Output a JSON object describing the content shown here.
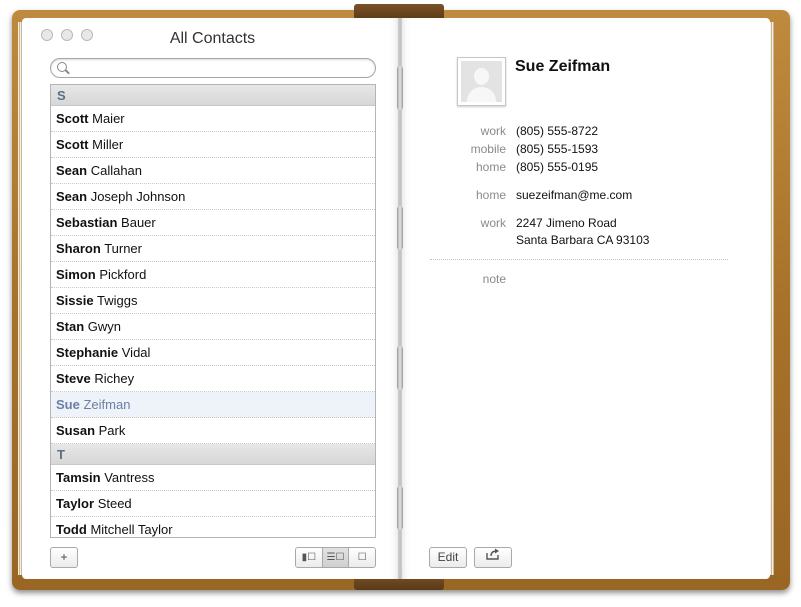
{
  "window": {
    "title": "All Contacts"
  },
  "search": {
    "placeholder": "",
    "value": ""
  },
  "contacts": {
    "sections": [
      {
        "letter": "S",
        "items": [
          {
            "first": "Scott",
            "last": "Maier"
          },
          {
            "first": "Scott",
            "last": "Miller"
          },
          {
            "first": "Sean",
            "last": "Callahan"
          },
          {
            "first": "Sean",
            "last": "Joseph Johnson"
          },
          {
            "first": "Sebastian",
            "last": "Bauer"
          },
          {
            "first": "Sharon",
            "last": "Turner"
          },
          {
            "first": "Simon",
            "last": "Pickford"
          },
          {
            "first": "Sissie",
            "last": "Twiggs"
          },
          {
            "first": "Stan",
            "last": "Gwyn"
          },
          {
            "first": "Stephanie",
            "last": "Vidal"
          },
          {
            "first": "Steve",
            "last": "Richey"
          },
          {
            "first": "Sue",
            "last": "Zeifman",
            "selected": true
          },
          {
            "first": "Susan",
            "last": "Park"
          }
        ]
      },
      {
        "letter": "T",
        "items": [
          {
            "first": "Tamsin",
            "last": "Vantress"
          },
          {
            "first": "Taylor",
            "last": "Steed"
          },
          {
            "first": "Todd",
            "last": "Mitchell Taylor"
          }
        ]
      }
    ]
  },
  "toolbar": {
    "add_label": "+",
    "view_modes": [
      "▮☐",
      "☰☐",
      "☐"
    ],
    "active_view": 1,
    "edit_label": "Edit",
    "share_icon": "share-icon"
  },
  "card": {
    "name": "Sue Zeifman",
    "phones": [
      {
        "label": "work",
        "value": "(805) 555-8722"
      },
      {
        "label": "mobile",
        "value": "(805) 555-1593"
      },
      {
        "label": "home",
        "value": "(805) 555-0195"
      }
    ],
    "email": {
      "label": "home",
      "value": "suezeifman@me.com"
    },
    "address": {
      "label": "work",
      "line1": "2247 Jimeno Road",
      "line2": "Santa Barbara CA 93103"
    },
    "note_label": "note"
  }
}
